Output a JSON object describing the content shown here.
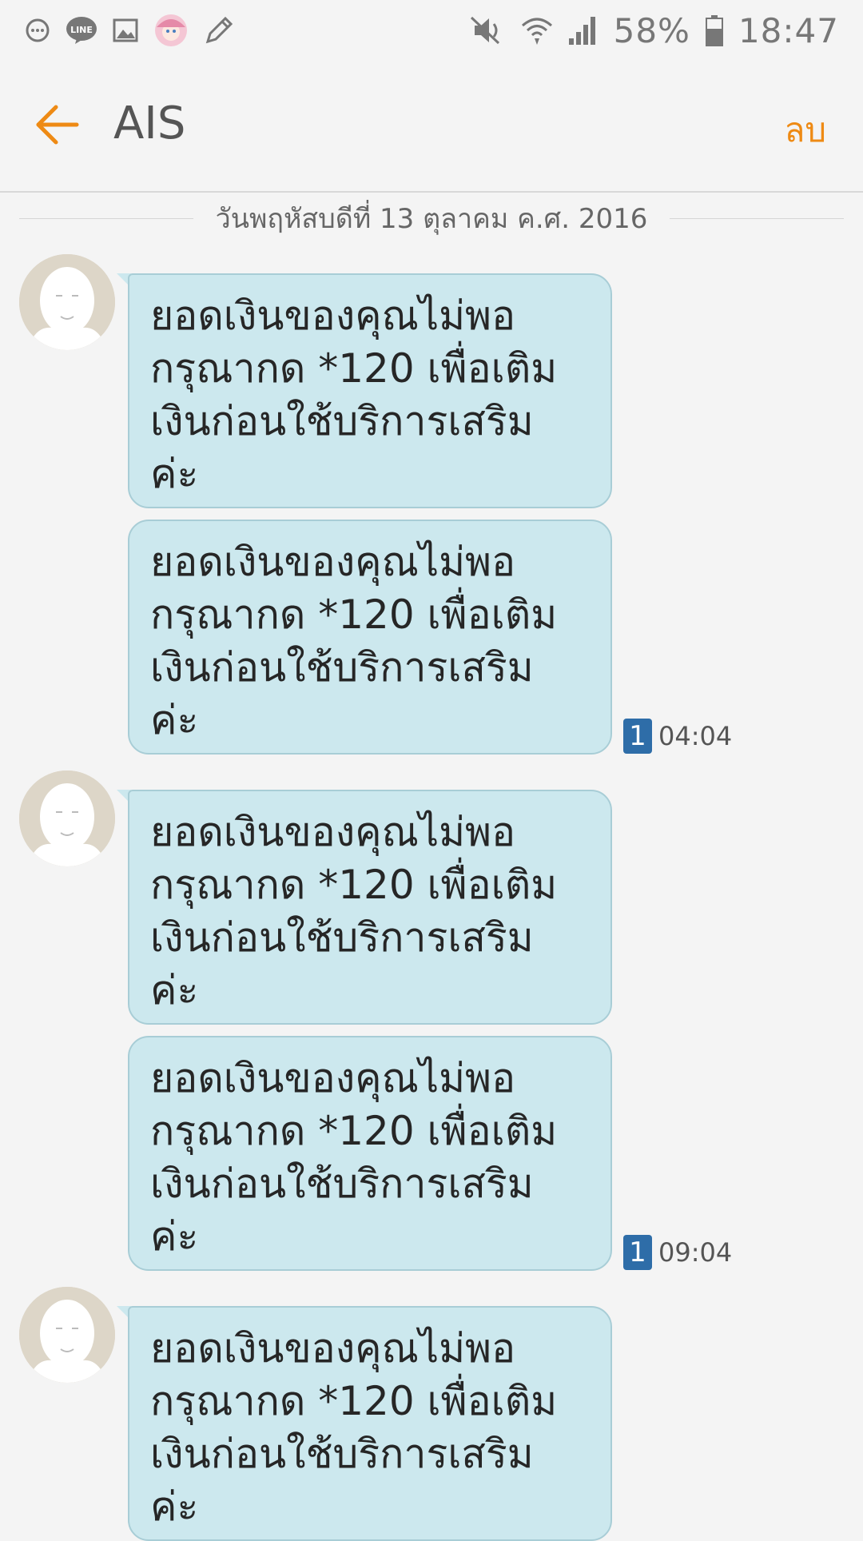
{
  "status_bar": {
    "battery": "58%",
    "clock": "18:47",
    "left_icons": [
      "chat-icon",
      "line-icon",
      "image-icon",
      "sticker-app-icon",
      "pencil-icon"
    ],
    "right_icons": [
      "mute-icon",
      "wifi-icon",
      "signal-icon",
      "battery-icon"
    ]
  },
  "app_bar": {
    "title": "AIS",
    "delete_label": "ลบ",
    "accent_color": "#ee8a14"
  },
  "conversation": {
    "date": "วันพฤหัสบดีที่ 13 ตุลาคม ค.ศ. 2016",
    "messages": [
      {
        "line1": "ยอดเงินของคุณไม่พอ",
        "line2": "กรุณากด *120 เพื่อเติม",
        "line3": "เงินก่อนใช้บริการเสริม",
        "line4": "ค่ะ"
      },
      {
        "line1": "ยอดเงินของคุณไม่พอ",
        "line2": "กรุณากด *120 เพื่อเติม",
        "line3": "เงินก่อนใช้บริการเสริม",
        "line4": "ค่ะ",
        "sim": "1",
        "time": "04:04"
      },
      {
        "line1": "ยอดเงินของคุณไม่พอ",
        "line2": "กรุณากด *120 เพื่อเติม",
        "line3": "เงินก่อนใช้บริการเสริม",
        "line4": "ค่ะ"
      },
      {
        "line1": "ยอดเงินของคุณไม่พอ",
        "line2": "กรุณากด *120 เพื่อเติม",
        "line3": "เงินก่อนใช้บริการเสริม",
        "line4": "ค่ะ",
        "sim": "1",
        "time": "09:04"
      },
      {
        "line1": "ยอดเงินของคุณไม่พอ",
        "line2": "กรุณากด *120 เพื่อเติม",
        "line3": "เงินก่อนใช้บริการเสริม",
        "line4": "ค่ะ"
      }
    ],
    "bubble_color": "#cce8ee",
    "sim_badge_color": "#2e6da8"
  }
}
